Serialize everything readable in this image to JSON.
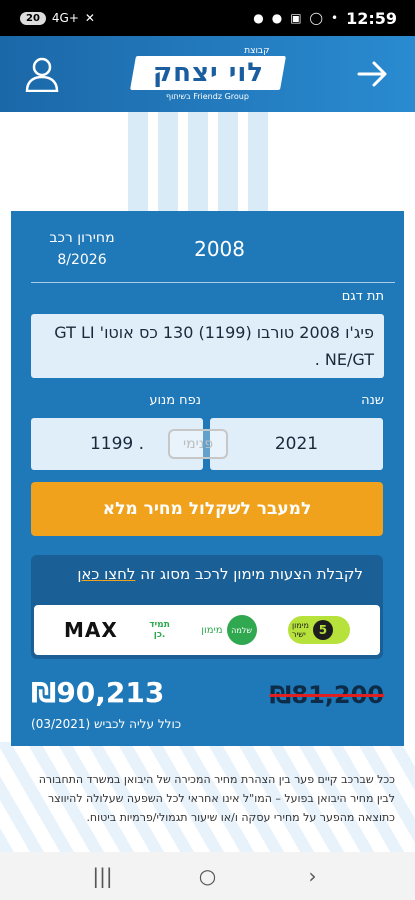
{
  "status_bar": {
    "badge": "20",
    "network": "4G+",
    "time": "12:59"
  },
  "header": {
    "logo_top": "קבוצת",
    "logo_main": "לוי יצחק",
    "logo_sub": "בשיתוף Friendz Group",
    "icons": [
      "user-icon",
      "arrow-right-icon"
    ]
  },
  "card": {
    "price_list_label": "מחירון רכב",
    "price_list_date": "8/2026",
    "model": "2008",
    "subtype_label": "תת דגם",
    "subtype_value": "פיג'ו 2008 טורבו (1199) 130 כס אוטו' GT LI NE/GT .",
    "year_label": "שנה",
    "year_value": "2021",
    "engine_label": "נפח מנוע",
    "engine_value": "1199 .",
    "cta": "למעבר לשקלול מחיר מלא",
    "finance_text": "לקבלת הצעות מימון לרכב מסוג זה ",
    "finance_link": "לחצו כאן",
    "partners": {
      "max": "MAX",
      "shlema_circle": "שלמה",
      "shlema_text": "מימון",
      "tamid_line1": "תמיד",
      "tamid_line2": "כן.",
      "yashir_num": "5",
      "yashir_line1": "מימון",
      "yashir_line2": "ישיר"
    },
    "new_price": "₪90,213",
    "old_price": "₪81,200",
    "vat_note": "כולל עליה לכביש (03/2021)"
  },
  "disclaimer": "ככל שברכב קיים פער בין הצהרת מחיר המכירה של היבואן במשרד התחבורה לבין מחיר היבואן בפועל – המו\"ל אינו אחראי לכל השפעה שעלולה להיווצר כתוצאה מהפער על מחירי עסקה ו/או שיעור תגמולי/פרמיות ביטוח.",
  "watermark": "פנימי",
  "nav": {
    "recent": "|||",
    "home": "○",
    "back": "›"
  }
}
